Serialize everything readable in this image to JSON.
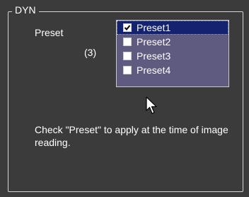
{
  "group": {
    "title": "DYN"
  },
  "preset": {
    "label": "Preset",
    "count": "(3)"
  },
  "list": {
    "items": [
      {
        "label": "Preset1",
        "checked": true,
        "selected": true
      },
      {
        "label": "Preset2",
        "checked": false,
        "selected": false
      },
      {
        "label": "Preset3",
        "checked": false,
        "selected": false
      },
      {
        "label": "Preset4",
        "checked": false,
        "selected": false
      }
    ]
  },
  "hint": "Check \"Preset\" to apply at the time of image reading.",
  "icons": {
    "cursor": "mouse-pointer-icon",
    "check": "checkmark-icon"
  }
}
